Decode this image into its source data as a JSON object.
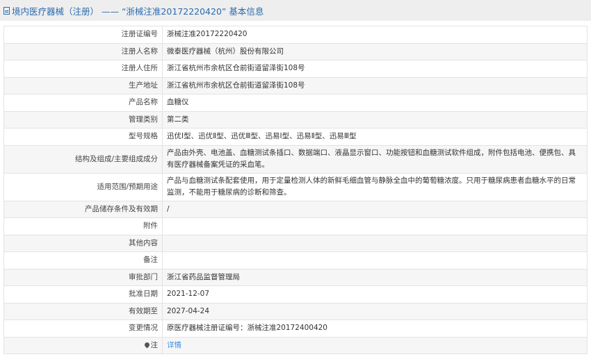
{
  "header": {
    "title": "境内医疗器械（注册） —— “浙械注准20172220420” 基本信息"
  },
  "rows": [
    {
      "label": "注册证编号",
      "value": "浙械注准20172220420"
    },
    {
      "label": "注册人名称",
      "value": "微泰医疗器械（杭州）股份有限公司"
    },
    {
      "label": "注册人住所",
      "value": "浙江省杭州市余杭区仓前街道留泽街108号"
    },
    {
      "label": "生产地址",
      "value": "浙江省杭州市余杭区仓前街道留泽街108号"
    },
    {
      "label": "产品名称",
      "value": "血糖仪"
    },
    {
      "label": "管理类别",
      "value": "第二类"
    },
    {
      "label": "型号规格",
      "value": "迅优Ⅰ型、迅优Ⅱ型、迅优Ⅲ型、迅易Ⅰ型、迅易Ⅱ型、迅易Ⅲ型"
    },
    {
      "label": "结构及组成/主要组成成分",
      "value": "产品由外壳、电池盖、血糖测试条插口、数据端口、液晶显示窗口、功能按钮和血糖测试软件组成，附件包括电池、便携包、具有医疗器械备案凭证的采血笔。"
    },
    {
      "label": "适用范围/预期用途",
      "value": "产品与血糖测试条配套使用，用于定量检测人体的新鲜毛细血管与静脉全血中的葡萄糖浓度。只用于糖尿病患者血糖水平的日常监测，不能用于糖尿病的诊断和筛查。"
    },
    {
      "label": "产品储存条件及有效期",
      "value": "/"
    },
    {
      "label": "附件",
      "value": ""
    },
    {
      "label": "其他内容",
      "value": ""
    },
    {
      "label": "备注",
      "value": ""
    },
    {
      "label": "审批部门",
      "value": "浙江省药品监督管理局"
    },
    {
      "label": "批准日期",
      "value": "2021-12-07"
    },
    {
      "label": "有效期至",
      "value": "2027-04-24"
    },
    {
      "label": "变更情况",
      "value": "原医疗器械注册证编号：浙械注准20172400420"
    }
  ],
  "note": {
    "label": "注",
    "link": "详情"
  }
}
